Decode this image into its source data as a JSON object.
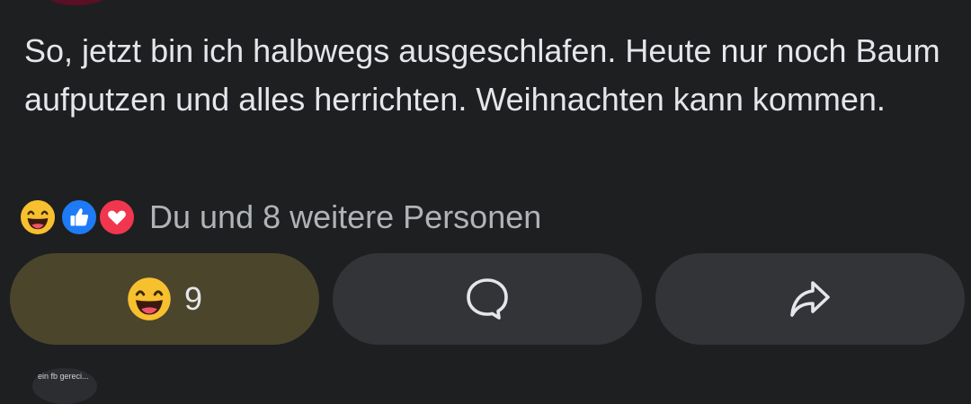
{
  "post": {
    "text": "So, jetzt bin ich halbwegs ausgeschlafen. Heute nur noch Baum aufputzen und alles herrichten. Weihnachten kann kommen."
  },
  "reactions": {
    "icons": [
      "haha-icon",
      "like-icon",
      "love-icon"
    ],
    "summary": "Du und 8 weitere Personen"
  },
  "actions": {
    "react_count": "9",
    "react_icon": "haha-icon",
    "comment_icon": "comment-bubble-icon",
    "share_icon": "share-arrow-icon"
  },
  "next_post": {
    "snippet": "ein fb gereci..."
  },
  "colors": {
    "background": "#1e1f21",
    "button": "#333437",
    "react_button_active": "#4b452c",
    "text_primary": "#e4e6eb",
    "text_secondary": "#b0b3b8",
    "like_blue": "#1e7bf5",
    "love_red": "#f0374f",
    "haha_yellow": "#f7c02f"
  }
}
